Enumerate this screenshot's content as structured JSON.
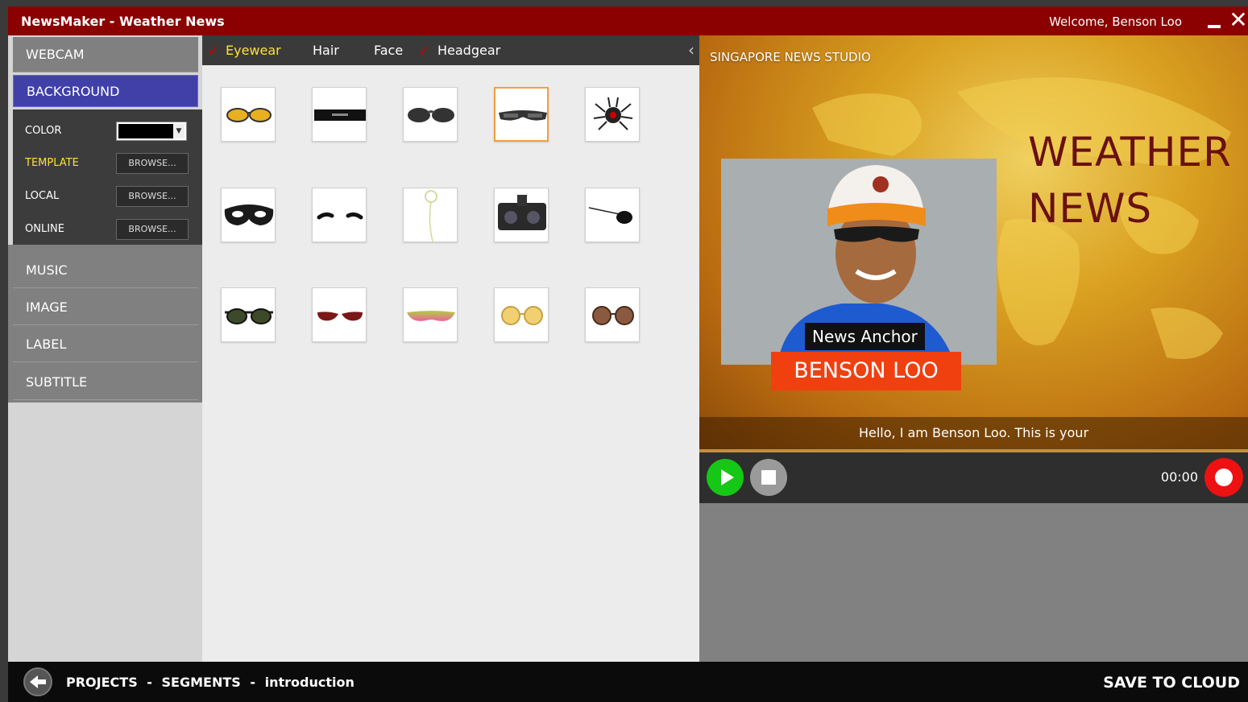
{
  "window": {
    "title": "NewsMaker - Weather News",
    "welcome": "Welcome,  Benson Loo"
  },
  "sidebar": {
    "items": [
      {
        "label": "WEBCAM"
      },
      {
        "label": "BACKGROUND"
      },
      {
        "label": "MUSIC"
      },
      {
        "label": "IMAGE"
      },
      {
        "label": "LABEL"
      },
      {
        "label": "SUBTITLE"
      }
    ],
    "background_options": {
      "color_label": "COLOR",
      "color_value": "#000000",
      "template_label": "TEMPLATE",
      "local_label": "LOCAL",
      "online_label": "ONLINE",
      "browse_label": "BROWSE..."
    }
  },
  "accessories": {
    "tabs": [
      {
        "label": "Eyewear",
        "checked": true,
        "active": true
      },
      {
        "label": "Hair",
        "checked": false
      },
      {
        "label": "Face",
        "checked": false
      },
      {
        "label": "Headgear",
        "checked": true
      }
    ],
    "items": [
      "yellow-aviator-icon",
      "censored-bar-icon",
      "black-sunglasses-icon",
      "wraparound-sunglasses-icon",
      "spider-icon",
      "masquerade-mask-icon",
      "eyebrows-icon",
      "monocle-icon",
      "night-vision-goggles-icon",
      "eyepatch-icon",
      "green-sunglasses-icon",
      "red-cat-eye-icon",
      "rainbow-shades-icon",
      "yellow-round-glasses-icon",
      "brown-round-glasses-icon"
    ],
    "selected_index": 3
  },
  "preview": {
    "studio_name": "SINGAPORE NEWS STUDIO",
    "headline_line1": "WEATHER",
    "headline_line2": "NEWS",
    "role": "News Anchor",
    "anchor_name": "BENSON LOO",
    "subtitle": "Hello, I am Benson Loo. This is your"
  },
  "player": {
    "time": "00:00"
  },
  "footer": {
    "crumb_projects": "PROJECTS",
    "crumb_segments": "SEGMENTS",
    "crumb_current": "introduction",
    "separator": "-",
    "save": "SAVE TO CLOUD"
  },
  "colors": {
    "title_bar": "#8b0000",
    "nav_active": "#4040a8",
    "highlight": "#ffe033",
    "name_banner": "#f04010",
    "play": "#16c716",
    "record": "#ee1111"
  }
}
